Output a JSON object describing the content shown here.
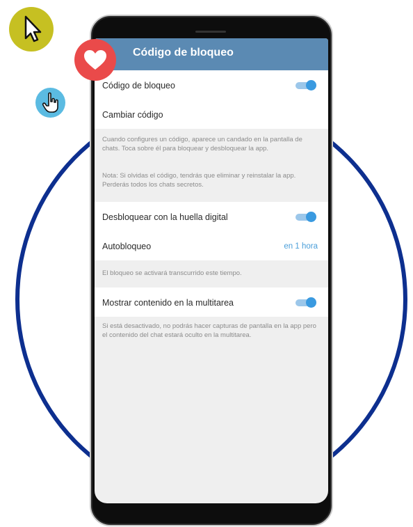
{
  "header": {
    "title": "Código de bloqueo"
  },
  "lock_section": {
    "toggle_label": "Código de bloqueo",
    "toggle_on": true,
    "change_label": "Cambiar código"
  },
  "notes": {
    "lock_info": "Cuando configures un código, aparece un candado en la pantalla de chats. Toca sobre él para bloquear y desbloquear la app.",
    "lock_warning": "Nota: Si olvidas el código, tendrás que eliminar y reinstalar la app. Perderás todos los chats secretos.",
    "auto_lock_info": "El bloqueo se activará transcurrido este tiempo.",
    "multitask_info": "Si está desactivado, no podrás hacer capturas de pantalla en la app pero el contenido del chat estará oculto en la multitarea."
  },
  "fingerprint": {
    "label": "Desbloquear con la huella digital",
    "toggle_on": true
  },
  "autolock": {
    "label": "Autobloqueo",
    "value": "en 1 hora"
  },
  "multitask": {
    "label": "Mostrar contenido en la multitarea",
    "toggle_on": true
  },
  "colors": {
    "appbar": "#5b8ab3",
    "accent": "#3a9ae0",
    "ring": "#0d2f8f",
    "heart_bubble": "#ea4a4a",
    "cursor_bubble": "#c6c022",
    "hand_bubble": "#5bbbe2"
  },
  "decorations": {
    "icons": [
      "cursor-arrow-icon",
      "heart-icon",
      "hand-pointer-icon"
    ]
  }
}
